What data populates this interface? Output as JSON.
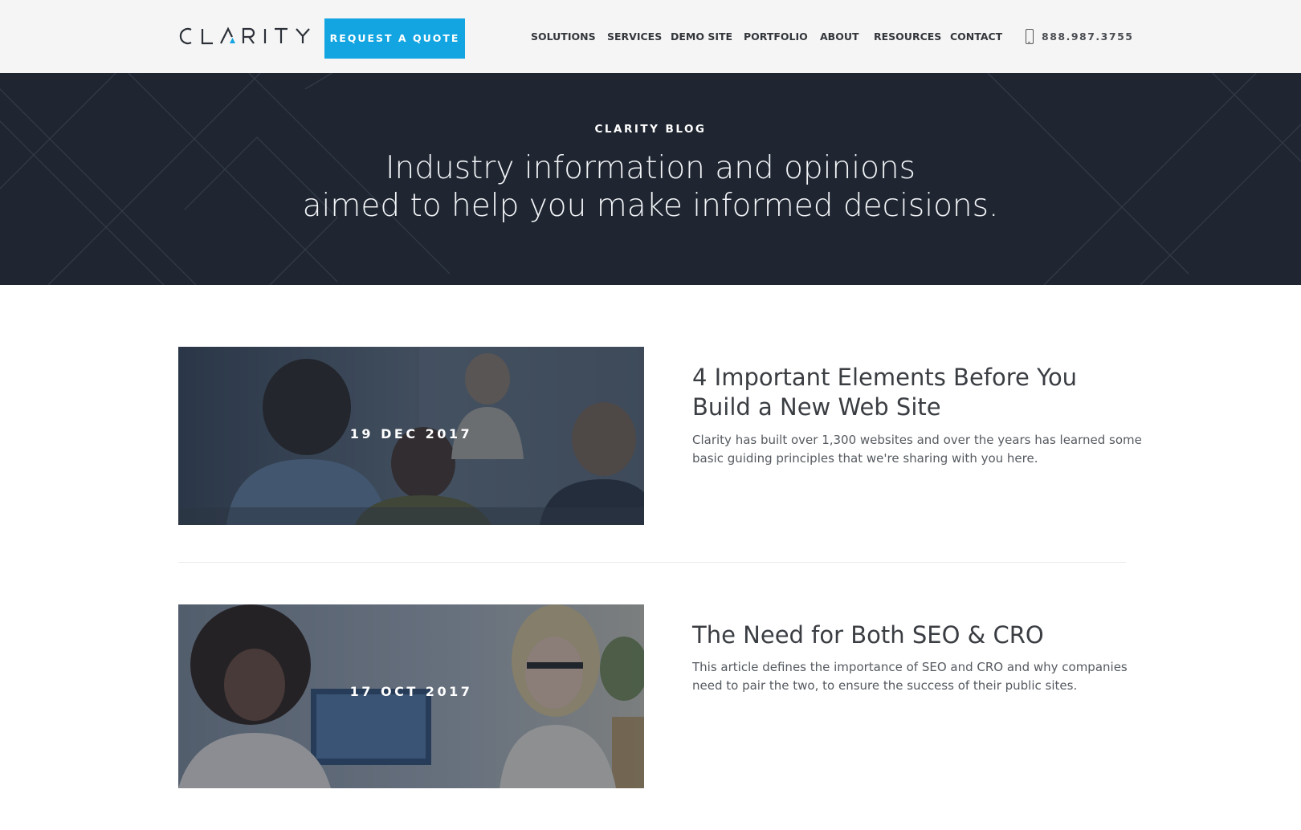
{
  "header": {
    "logo_text": "CLARITY",
    "quote_button": "REQUEST A QUOTE",
    "nav": [
      "SOLUTIONS",
      "SERVICES",
      "DEMO SITE",
      "PORTFOLIO",
      "ABOUT",
      "RESOURCES",
      "CONTACT"
    ],
    "phone": "888.987.3755",
    "accent_color": "#12a5e1"
  },
  "hero": {
    "kicker": "CLARITY BLOG",
    "title_line1": "Industry information and opinions",
    "title_line2": "aimed to help you make informed decisions.",
    "background_color": "#1f2631"
  },
  "posts": [
    {
      "date": "19 DEC 2017",
      "title": "4 Important Elements Before You Build a New Web Site",
      "excerpt": "Clarity has built over 1,300 websites and over the years has learned some basic guiding principles that we're sharing with you here."
    },
    {
      "date": "17 OCT 2017",
      "title": "The Need for Both SEO & CRO",
      "excerpt": "This article defines the importance of SEO and CRO and why companies need to pair the two, to ensure the success of their public sites."
    }
  ]
}
